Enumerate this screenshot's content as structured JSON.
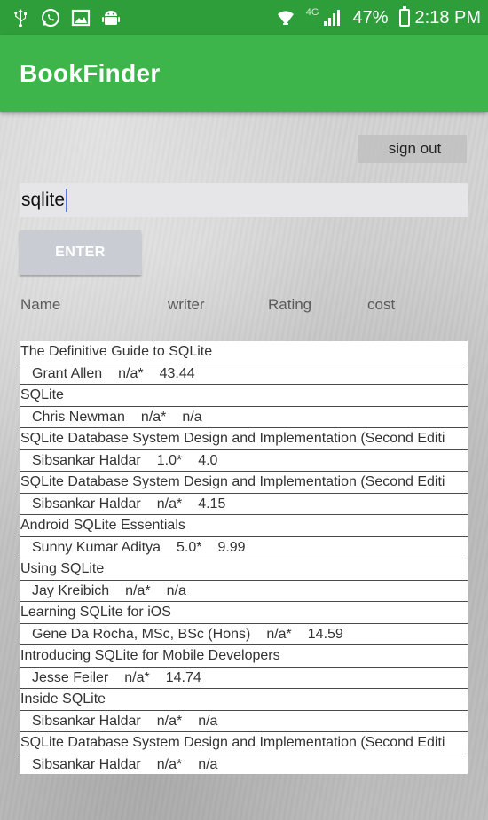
{
  "status_bar": {
    "battery": "47%",
    "time": "2:18 PM",
    "network": "4G"
  },
  "app": {
    "title": "BookFinder"
  },
  "actions": {
    "signout_label": "sign out",
    "enter_label": "ENTER"
  },
  "search": {
    "value": "sqlite"
  },
  "columns": [
    "Name",
    "writer",
    "Rating",
    "cost"
  ],
  "results": [
    {
      "title": "The Definitive Guide to SQLite",
      "author": "Grant Allen",
      "rating": "n/a*",
      "cost": "43.44"
    },
    {
      "title": "SQLite",
      "author": "Chris Newman",
      "rating": "n/a*",
      "cost": "n/a"
    },
    {
      "title": "SQLite Database System Design and Implementation (Second Editi",
      "author": "Sibsankar Haldar",
      "rating": "1.0*",
      "cost": "4.0"
    },
    {
      "title": "SQLite Database System Design and Implementation (Second Editi",
      "author": "Sibsankar Haldar",
      "rating": "n/a*",
      "cost": "4.15"
    },
    {
      "title": "Android SQLite Essentials",
      "author": "Sunny Kumar Aditya",
      "rating": "5.0*",
      "cost": "9.99"
    },
    {
      "title": "Using SQLite",
      "author": "Jay Kreibich",
      "rating": "n/a*",
      "cost": "n/a"
    },
    {
      "title": "Learning SQLite for iOS",
      "author": "Gene Da Rocha, MSc, BSc (Hons)",
      "rating": "n/a*",
      "cost": "14.59"
    },
    {
      "title": "Introducing SQLite for Mobile Developers",
      "author": "Jesse Feiler",
      "rating": "n/a*",
      "cost": "14.74"
    },
    {
      "title": "Inside SQLite",
      "author": "Sibsankar Haldar",
      "rating": "n/a*",
      "cost": "n/a"
    },
    {
      "title": "SQLite Database System Design and Implementation (Second Editi",
      "author": "Sibsankar Haldar",
      "rating": "n/a*",
      "cost": "n/a"
    }
  ],
  "colors": {
    "status_bar": "#2e9e3b",
    "app_bar": "#3db54a",
    "caret": "#5a7bdc"
  },
  "icons": {
    "status_left": [
      "usb-icon",
      "whatsapp-icon",
      "image-icon",
      "android-icon"
    ],
    "status_right": [
      "wifi-icon",
      "signal-icon",
      "battery-icon"
    ]
  }
}
